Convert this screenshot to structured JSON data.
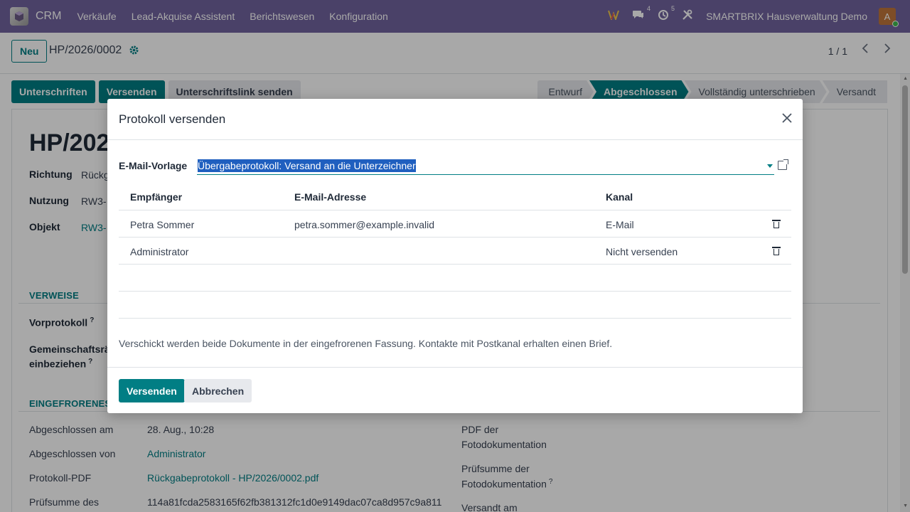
{
  "navbar": {
    "app_name": "CRM",
    "menu": [
      "Verkäufe",
      "Lead-Akquise Assistent",
      "Berichtswesen",
      "Konfiguration"
    ],
    "chat_count": "4",
    "activity_count": "5",
    "company": "SMARTBRIX Hausverwaltung Demo",
    "avatar_letter": "A"
  },
  "control_panel": {
    "new_label": "Neu",
    "record_title": "HP/2026/0002",
    "pager": "1 / 1"
  },
  "action_buttons": [
    "Unterschriften",
    "Versenden",
    "Unterschriftslink senden"
  ],
  "stages": [
    "Entwurf",
    "Abgeschlossen",
    "Vollständig unterschrieben",
    "Versandt"
  ],
  "active_stage": "Abgeschlossen",
  "form": {
    "heading": "HP/202",
    "richtung_label": "Richtung",
    "richtung_value": "Rückg",
    "nutzung_label": "Nutzung",
    "nutzung_value": "RW3-",
    "objekt_label": "Objekt",
    "objekt_value": "RW3-",
    "section_verweise": "VERWEISE",
    "vorprotokoll_label": "Vorprotokoll",
    "gemeinschaft_label_1": "Gemeinschaftsräu",
    "gemeinschaft_label_2": "einbeziehen",
    "section_frozen": "EINGEFRORENES D",
    "abgeschlossen_am_label": "Abgeschlossen am",
    "abgeschlossen_am_value": "28. Aug., 10:28",
    "abgeschlossen_von_label": "Abgeschlossen von",
    "abgeschlossen_von_value": "Administrator",
    "protokoll_pdf_label": "Protokoll-PDF",
    "protokoll_pdf_value": "Rückgabeprotokoll - HP/2026/0002.pdf",
    "pruefsumme_label": "Prüfsumme des",
    "pruefsumme_value": "114a81fcda2583165f62fb381312fc1d0e9149dac07ca8d957c9a811",
    "pdf_foto_label_1": "PDF der",
    "pdf_foto_label_2": "Fotodokumentation",
    "pruef_foto_label_1": "Prüfsumme der",
    "pruef_foto_label_2": "Fotodokumentation",
    "versandt_am_label": "Versandt am",
    "tooltip_mark": "?"
  },
  "modal": {
    "title": "Protokoll versenden",
    "template_label": "E-Mail-Vorlage",
    "template_value": "Übergabeprotokoll: Versand an die Unterzeichner",
    "columns": [
      "Empfänger",
      "E-Mail-Adresse",
      "Kanal"
    ],
    "rows": [
      {
        "recipient": "Petra Sommer",
        "email": "petra.sommer@example.invalid",
        "channel": "E-Mail"
      },
      {
        "recipient": "Administrator",
        "email": "",
        "channel": "Nicht versenden"
      }
    ],
    "note": "Verschickt werden beide Dokumente in der eingefrorenen Fassung. Kontakte mit Postkanal erhalten einen Brief.",
    "send_label": "Versenden",
    "cancel_label": "Abbrechen"
  },
  "colors": {
    "navbar": "#71639e",
    "primary": "#017e84",
    "selection": "#1f5fbf"
  }
}
